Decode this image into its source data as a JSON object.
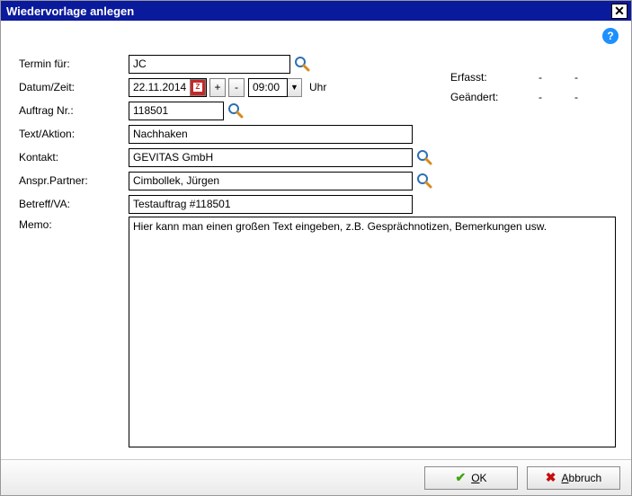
{
  "window": {
    "title": "Wiedervorlage anlegen"
  },
  "meta": {
    "erfasst_label": "Erfasst:",
    "erfasst_v1": "-",
    "erfasst_v2": "-",
    "geaendert_label": "Geändert:",
    "geaendert_v1": "-",
    "geaendert_v2": "-"
  },
  "labels": {
    "termin_fuer": "Termin für:",
    "datum_zeit": "Datum/Zeit:",
    "auftrag_nr": "Auftrag Nr.:",
    "text_aktion": "Text/Aktion:",
    "kontakt": "Kontakt:",
    "anspr_partner": "Anspr.Partner:",
    "betreff_va": "Betreff/VA:",
    "memo": "Memo:",
    "uhr": "Uhr"
  },
  "values": {
    "termin_fuer": "JC",
    "datum": "22.11.2014",
    "plus": "+",
    "minus": "-",
    "zeit": "09:00",
    "auftrag_nr": "118501",
    "text_aktion": "Nachhaken",
    "kontakt": "GEVITAS GmbH",
    "anspr_partner": "Cimbollek, Jürgen",
    "betreff_va": "Testauftrag #118501",
    "memo": "Hier kann man einen großen Text eingeben, z.B. Gesprächnotizen, Bemerkungen usw."
  },
  "buttons": {
    "ok_prefix": "O",
    "ok_rest": "K",
    "abbruch_prefix": "A",
    "abbruch_rest": "bbruch"
  },
  "icons": {
    "help": "?",
    "close": "✕",
    "check": "✔",
    "cross": "✖",
    "dropdown": "▼"
  }
}
